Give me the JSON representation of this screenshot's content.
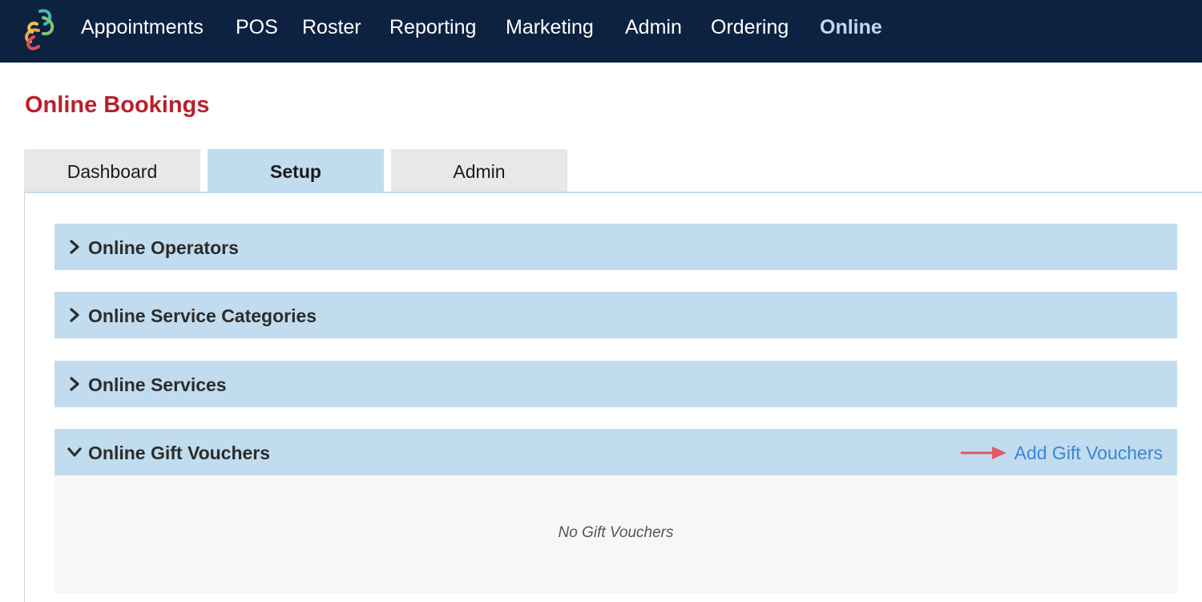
{
  "nav": {
    "items": [
      {
        "label": "Appointments"
      },
      {
        "label": "POS"
      },
      {
        "label": "Roster"
      },
      {
        "label": "Reporting"
      },
      {
        "label": "Marketing"
      },
      {
        "label": "Admin"
      },
      {
        "label": "Ordering"
      },
      {
        "label": "Online"
      }
    ],
    "active": "Online",
    "logo_icon": "brand-swirl-icon"
  },
  "page": {
    "title": "Online Bookings"
  },
  "tabs": [
    {
      "label": "Dashboard"
    },
    {
      "label": "Setup"
    },
    {
      "label": "Admin"
    }
  ],
  "active_tab": "Setup",
  "sections": [
    {
      "label": "Online Operators",
      "state": "collapsed"
    },
    {
      "label": "Online Service Categories",
      "state": "collapsed"
    },
    {
      "label": "Online Services",
      "state": "collapsed"
    },
    {
      "label": "Online Gift Vouchers",
      "state": "expanded",
      "action_label": "Add Gift Vouchers",
      "empty_text": "No Gift Vouchers"
    }
  ],
  "icons": {
    "collapsed": "chevron-right-icon",
    "expanded": "chevron-down-icon",
    "callout": "red-arrow-icon"
  },
  "colors": {
    "nav_bg": "#0d2240",
    "nav_active": "#bcdaf2",
    "title": "#b8202d",
    "section_bg": "#c1dcee",
    "tab_bg": "#e8e8e8",
    "link": "#3a86d6",
    "arrow": "#e25a64"
  }
}
